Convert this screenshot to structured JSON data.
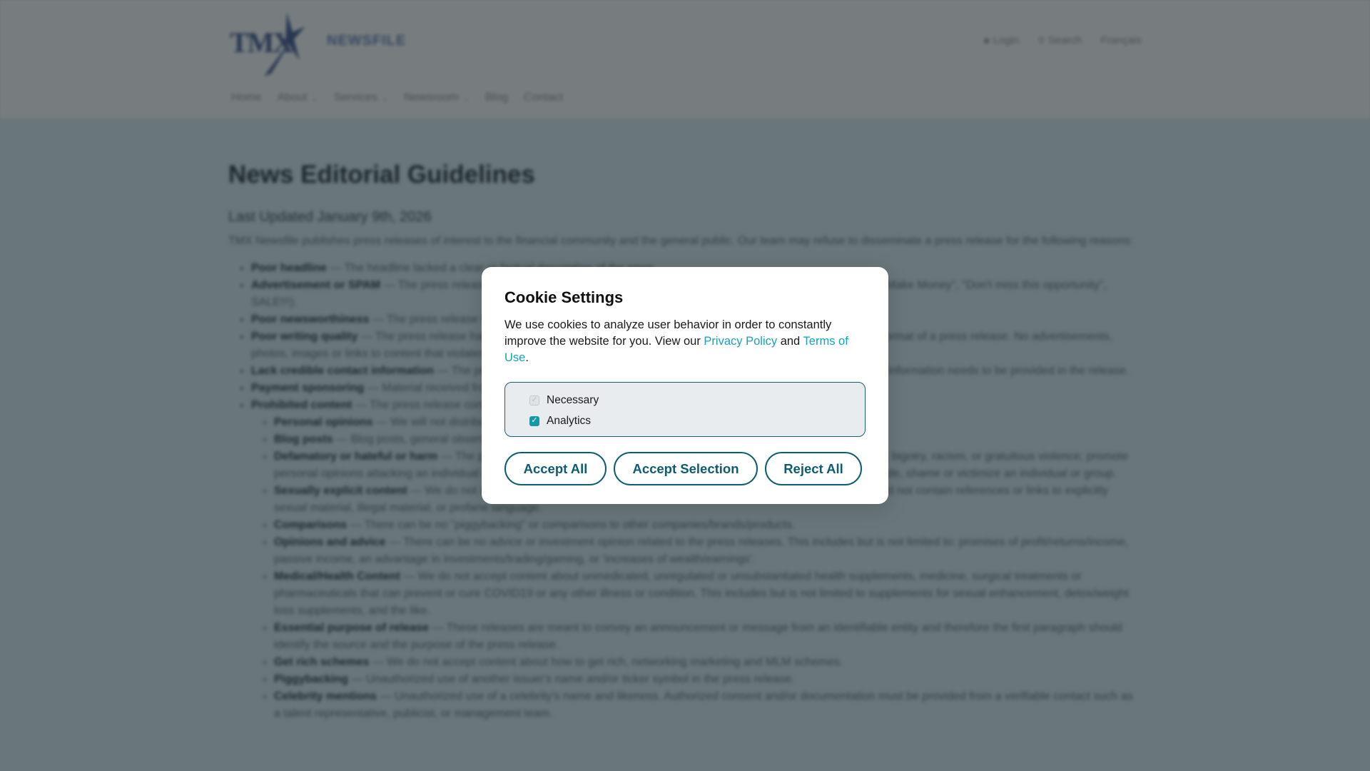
{
  "header": {
    "logo_text": "TMX",
    "brand": "NEWSFILE",
    "util": [
      {
        "icon": "user-icon",
        "label": "Login"
      },
      {
        "icon": "search-icon",
        "label": "Search"
      },
      {
        "icon": "",
        "label": "Français"
      }
    ],
    "nav": [
      {
        "label": "Home",
        "has_dropdown": false
      },
      {
        "label": "About",
        "has_dropdown": true
      },
      {
        "label": "Services",
        "has_dropdown": true
      },
      {
        "label": "Newsroom",
        "has_dropdown": true
      },
      {
        "label": "Blog",
        "has_dropdown": false
      },
      {
        "label": "Contact",
        "has_dropdown": false
      }
    ]
  },
  "main": {
    "title": "News Editorial Guidelines",
    "updated": "Last Updated January 9th, 2026",
    "intro": "TMX Newsfile publishes press releases of interest to the financial community and the general public. Our team may refuse to disseminate a press release for the following reasons:",
    "rules": [
      {
        "term": "Poor headline",
        "text": " — The headline lacked a clear or factual description of the news."
      },
      {
        "term": "Advertisement or SPAM",
        "text": " — The press release reads as an advertisement or promotional material (examples include FREE, \"Make Money\", \"Don't miss this opportunity\", SALE!!!)."
      },
      {
        "term": "Poor newsworthiness",
        "text": " — The press release lacks news value for the financial community or the general public."
      },
      {
        "term": "Poor writing quality",
        "text": " — The press release has poor grammar, spelling or formatting. The body of the release should use the format of a press release. No advertisements, photos, images or links to content that violates these guidelines are permitted."
      },
      {
        "term": "Lack credible contact information",
        "text": " — The press release must contain a verifiable contact person and corresponding contact information needs to be provided in the release."
      },
      {
        "term": "Payment sponsoring",
        "text": " — Material received from paid promotion or sponsors."
      },
      {
        "term": "Prohibited content",
        "text": " — The press release contains content that we do not accept, including:"
      }
    ],
    "subrules": [
      {
        "term": "Personal opinions",
        "text": " — We will not distribute personal opinions, blogs or editorials from individuals or groups."
      },
      {
        "term": "Blog posts",
        "text": " — Blog posts, general observations or content that is not news will be rejected."
      },
      {
        "term": "Defamatory or hateful or harm",
        "text": " — The press release may not contain statements that are defamatory or promote hatred, bigotry, racism, or gratuitous violence; promote personal opinions attacking an individual or group; maliciously affect a company's stock; or make, defame, defraud, degrade, shame or victimize an individual or group."
      },
      {
        "term": "Sexually explicit content",
        "text": " — We do not accept content about sexually explicit material or products. These releases should not contain references or links to explicitly sexual material, illegal material, or profane language."
      },
      {
        "term": "Comparisons",
        "text": " — There can be no \"piggybacking\" or comparisons to other companies/brands/products."
      },
      {
        "term": "Opinions and advice",
        "text": " — There can be no advice or investment opinion related to the press releases. This includes but is not limited to: promises of profit/returns/income, passive income, an advantage in investments/trading/gaming, or 'increases of wealth/earnings'."
      },
      {
        "term": "Medical/Health Content",
        "text": " — We do not accept content about unmedicated, unregulated or unsubstantiated health supplements, medicine, surgical treatments or pharmaceuticals that can prevent or cure COVID19 or any other illness or condition. This includes but is not limited to supplements for sexual enhancement, detox/weight loss supplements, and the like."
      },
      {
        "term": "Essential purpose of release",
        "text": " — These releases are meant to convey an announcement or message from an identifiable entity and therefore the first paragraph should identify the source and the purpose of the press release."
      },
      {
        "term": "Get rich schemes",
        "text": " — We do not accept content about how to get rich, networking marketing and MLM schemes."
      },
      {
        "term": "Piggybacking",
        "text": " — Unauthorized use of another issuer's name and/or ticker symbol in the press release."
      },
      {
        "term": "Celebrity mentions",
        "text": " — Unauthorized use of a celebrity's name and likeness. Authorized consent and/or documentation must be provided from a verifiable contact such as a talent representative, publicist, or management team."
      }
    ]
  },
  "cookie_modal": {
    "title": "Cookie Settings",
    "text_before": "We use cookies to analyze user behavior in order to constantly improve the website for you. View our ",
    "privacy_link": "Privacy Policy",
    "text_middle": " and ",
    "terms_link": "Terms of Use",
    "text_after": ".",
    "options": [
      {
        "label": "Necessary",
        "checked": true,
        "disabled": true
      },
      {
        "label": "Analytics",
        "checked": true,
        "disabled": false
      }
    ],
    "buttons": {
      "accept_all": "Accept All",
      "accept_selection": "Accept Selection",
      "reject_all": "Reject All"
    }
  },
  "colors": {
    "accent": "#0d5c70",
    "link": "#17a2b8",
    "checkbox": "#1598a8"
  }
}
